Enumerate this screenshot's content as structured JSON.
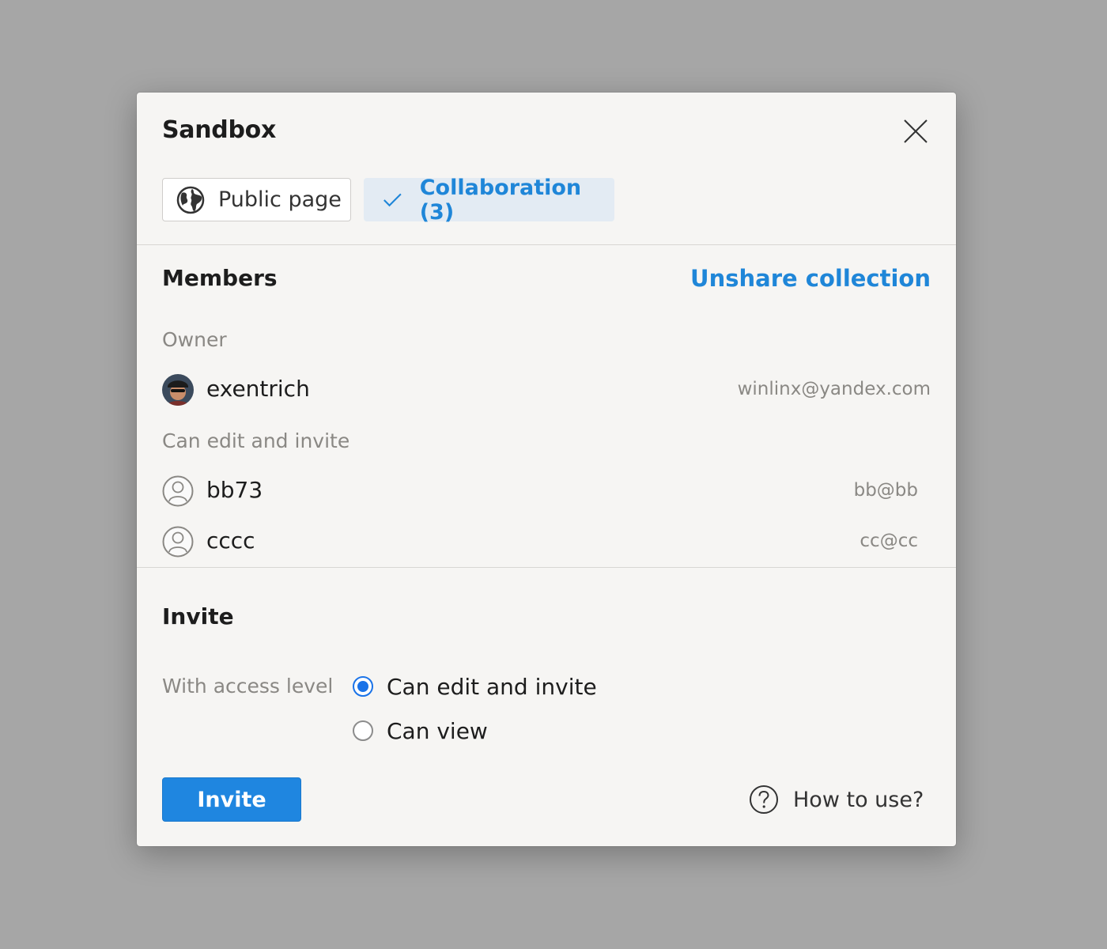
{
  "dialog": {
    "title": "Sandbox"
  },
  "tabs": [
    {
      "label": "Public page",
      "icon": "globe-icon",
      "selected": false
    },
    {
      "label": "Collaboration (3)",
      "icon": "checkmark-icon",
      "selected": true
    }
  ],
  "members": {
    "heading": "Members",
    "unshare_label": "Unshare collection",
    "owner_label": "Owner",
    "owner": {
      "name": "exentrich",
      "email": "winlinx@yandex.com"
    },
    "editors_label": "Can edit and invite",
    "editors": [
      {
        "name": "bb73",
        "email": "bb@bb"
      },
      {
        "name": "cccc",
        "email": "cc@cc"
      }
    ]
  },
  "invite": {
    "heading": "Invite",
    "access_label": "With access level",
    "options": [
      {
        "label": "Can edit and invite",
        "checked": true
      },
      {
        "label": "Can view",
        "checked": false
      }
    ],
    "button_label": "Invite",
    "help_label": "How to use?"
  },
  "colors": {
    "accent": "#1f86e0",
    "link": "#1f86d8",
    "selected_tab_bg": "#e3ebf3",
    "dialog_bg": "#f6f5f3",
    "overlay_bg": "#a6a6a6"
  }
}
